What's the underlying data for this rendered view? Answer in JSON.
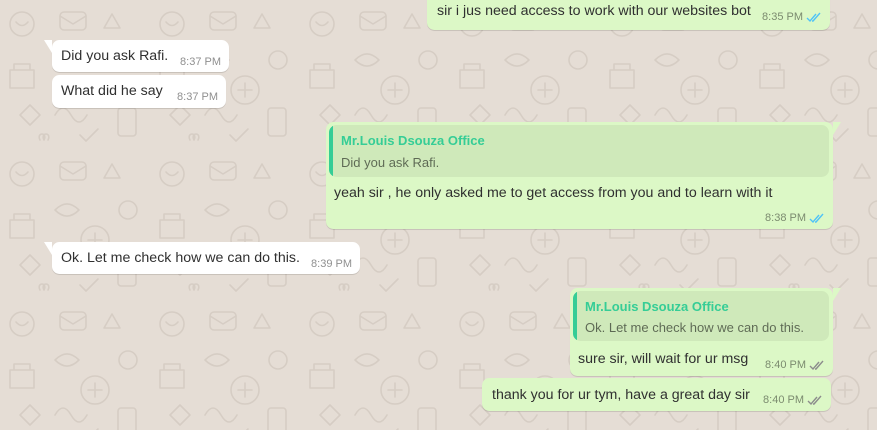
{
  "chat": {
    "messages": [
      {
        "direction": "outgoing",
        "text": "sir i jus need access to work with our websites bot",
        "time": "8:35 PM",
        "status": "read"
      },
      {
        "direction": "incoming",
        "text": "Did you ask Rafi.",
        "time": "8:37 PM"
      },
      {
        "direction": "incoming",
        "text": "What did he say",
        "time": "8:37 PM"
      },
      {
        "direction": "outgoing",
        "quote": {
          "author": "Mr.Louis Dsouza Office",
          "text": "Did you ask Rafi."
        },
        "text": "yeah  sir , he  only asked me to get access from you and to learn with it",
        "time": "8:38 PM",
        "status": "read"
      },
      {
        "direction": "incoming",
        "text": "Ok. Let me check how we can do this.",
        "time": "8:39 PM"
      },
      {
        "direction": "outgoing",
        "quote": {
          "author": "Mr.Louis Dsouza Office",
          "text": "Ok. Let me check how we can do this."
        },
        "text": "sure sir, will wait for ur msg",
        "time": "8:40 PM",
        "status": "delivered"
      },
      {
        "direction": "outgoing",
        "text": "thank you for ur tym, have a great day sir",
        "time": "8:40 PM",
        "status": "delivered"
      }
    ]
  },
  "colors": {
    "background": "#e5ddd5",
    "incoming_bubble": "#ffffff",
    "outgoing_bubble": "#dcf8c6",
    "quote_background": "#cfe9ba",
    "quote_accent": "#35cd96",
    "read_tick": "#4fc3f7",
    "delivered_tick": "#8c8c8c"
  },
  "icons": {
    "read": "double-check-blue-icon",
    "delivered": "double-check-grey-icon"
  }
}
